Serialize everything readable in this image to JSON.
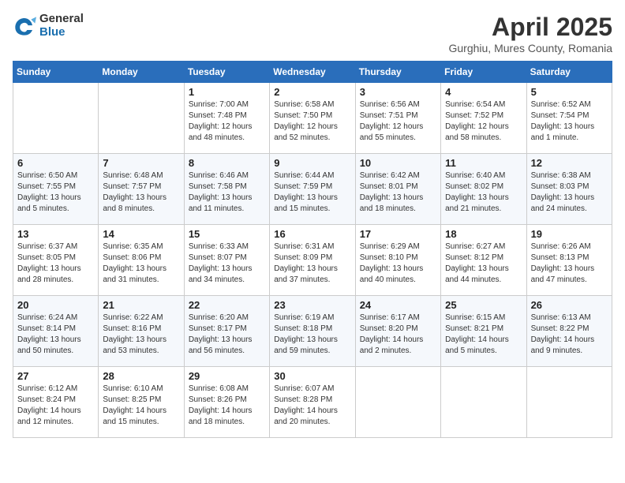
{
  "logo": {
    "general": "General",
    "blue": "Blue"
  },
  "title": "April 2025",
  "subtitle": "Gurghiu, Mures County, Romania",
  "days_header": [
    "Sunday",
    "Monday",
    "Tuesday",
    "Wednesday",
    "Thursday",
    "Friday",
    "Saturday"
  ],
  "weeks": [
    [
      {
        "day": "",
        "info": ""
      },
      {
        "day": "",
        "info": ""
      },
      {
        "day": "1",
        "info": "Sunrise: 7:00 AM\nSunset: 7:48 PM\nDaylight: 12 hours\nand 48 minutes."
      },
      {
        "day": "2",
        "info": "Sunrise: 6:58 AM\nSunset: 7:50 PM\nDaylight: 12 hours\nand 52 minutes."
      },
      {
        "day": "3",
        "info": "Sunrise: 6:56 AM\nSunset: 7:51 PM\nDaylight: 12 hours\nand 55 minutes."
      },
      {
        "day": "4",
        "info": "Sunrise: 6:54 AM\nSunset: 7:52 PM\nDaylight: 12 hours\nand 58 minutes."
      },
      {
        "day": "5",
        "info": "Sunrise: 6:52 AM\nSunset: 7:54 PM\nDaylight: 13 hours\nand 1 minute."
      }
    ],
    [
      {
        "day": "6",
        "info": "Sunrise: 6:50 AM\nSunset: 7:55 PM\nDaylight: 13 hours\nand 5 minutes."
      },
      {
        "day": "7",
        "info": "Sunrise: 6:48 AM\nSunset: 7:57 PM\nDaylight: 13 hours\nand 8 minutes."
      },
      {
        "day": "8",
        "info": "Sunrise: 6:46 AM\nSunset: 7:58 PM\nDaylight: 13 hours\nand 11 minutes."
      },
      {
        "day": "9",
        "info": "Sunrise: 6:44 AM\nSunset: 7:59 PM\nDaylight: 13 hours\nand 15 minutes."
      },
      {
        "day": "10",
        "info": "Sunrise: 6:42 AM\nSunset: 8:01 PM\nDaylight: 13 hours\nand 18 minutes."
      },
      {
        "day": "11",
        "info": "Sunrise: 6:40 AM\nSunset: 8:02 PM\nDaylight: 13 hours\nand 21 minutes."
      },
      {
        "day": "12",
        "info": "Sunrise: 6:38 AM\nSunset: 8:03 PM\nDaylight: 13 hours\nand 24 minutes."
      }
    ],
    [
      {
        "day": "13",
        "info": "Sunrise: 6:37 AM\nSunset: 8:05 PM\nDaylight: 13 hours\nand 28 minutes."
      },
      {
        "day": "14",
        "info": "Sunrise: 6:35 AM\nSunset: 8:06 PM\nDaylight: 13 hours\nand 31 minutes."
      },
      {
        "day": "15",
        "info": "Sunrise: 6:33 AM\nSunset: 8:07 PM\nDaylight: 13 hours\nand 34 minutes."
      },
      {
        "day": "16",
        "info": "Sunrise: 6:31 AM\nSunset: 8:09 PM\nDaylight: 13 hours\nand 37 minutes."
      },
      {
        "day": "17",
        "info": "Sunrise: 6:29 AM\nSunset: 8:10 PM\nDaylight: 13 hours\nand 40 minutes."
      },
      {
        "day": "18",
        "info": "Sunrise: 6:27 AM\nSunset: 8:12 PM\nDaylight: 13 hours\nand 44 minutes."
      },
      {
        "day": "19",
        "info": "Sunrise: 6:26 AM\nSunset: 8:13 PM\nDaylight: 13 hours\nand 47 minutes."
      }
    ],
    [
      {
        "day": "20",
        "info": "Sunrise: 6:24 AM\nSunset: 8:14 PM\nDaylight: 13 hours\nand 50 minutes."
      },
      {
        "day": "21",
        "info": "Sunrise: 6:22 AM\nSunset: 8:16 PM\nDaylight: 13 hours\nand 53 minutes."
      },
      {
        "day": "22",
        "info": "Sunrise: 6:20 AM\nSunset: 8:17 PM\nDaylight: 13 hours\nand 56 minutes."
      },
      {
        "day": "23",
        "info": "Sunrise: 6:19 AM\nSunset: 8:18 PM\nDaylight: 13 hours\nand 59 minutes."
      },
      {
        "day": "24",
        "info": "Sunrise: 6:17 AM\nSunset: 8:20 PM\nDaylight: 14 hours\nand 2 minutes."
      },
      {
        "day": "25",
        "info": "Sunrise: 6:15 AM\nSunset: 8:21 PM\nDaylight: 14 hours\nand 5 minutes."
      },
      {
        "day": "26",
        "info": "Sunrise: 6:13 AM\nSunset: 8:22 PM\nDaylight: 14 hours\nand 9 minutes."
      }
    ],
    [
      {
        "day": "27",
        "info": "Sunrise: 6:12 AM\nSunset: 8:24 PM\nDaylight: 14 hours\nand 12 minutes."
      },
      {
        "day": "28",
        "info": "Sunrise: 6:10 AM\nSunset: 8:25 PM\nDaylight: 14 hours\nand 15 minutes."
      },
      {
        "day": "29",
        "info": "Sunrise: 6:08 AM\nSunset: 8:26 PM\nDaylight: 14 hours\nand 18 minutes."
      },
      {
        "day": "30",
        "info": "Sunrise: 6:07 AM\nSunset: 8:28 PM\nDaylight: 14 hours\nand 20 minutes."
      },
      {
        "day": "",
        "info": ""
      },
      {
        "day": "",
        "info": ""
      },
      {
        "day": "",
        "info": ""
      }
    ]
  ]
}
